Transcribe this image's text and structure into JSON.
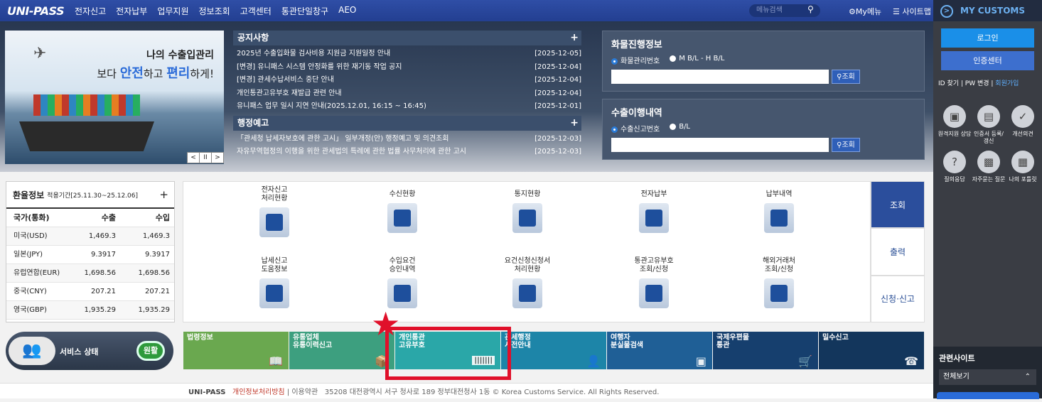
{
  "header": {
    "logo": "UNI-PASS",
    "menu": [
      "전자신고",
      "전자납부",
      "업무지원",
      "정보조회",
      "고객센터",
      "통관단일창구",
      "AEO"
    ],
    "search_placeholder": "메뉴검색",
    "mymenu": "My메뉴",
    "sitemap": "사이트맵"
  },
  "banner": {
    "line1": "나의 수출입관리",
    "line2_pre": "보다 ",
    "line2_a": "안전",
    "line2_mid": "하고 ",
    "line2_b": "편리",
    "line2_post": "하게!",
    "ctrl": [
      "<",
      "II",
      ">"
    ]
  },
  "notice": {
    "title": "공지사항",
    "items": [
      {
        "t": "2025년 수출입화물 검사비용 지원금 지원일정 안내",
        "d": "[2025-12-05]"
      },
      {
        "t": "[변경] 유니패스 시스템 안정화를 위한 재기동 작업 공지",
        "d": "[2025-12-04]"
      },
      {
        "t": "[변경] 관세수납서비스 중단 안내",
        "d": "[2025-12-04]"
      },
      {
        "t": "개인통관고유부호 재발급 관련 안내",
        "d": "[2025-12-04]"
      },
      {
        "t": "유니패스 업무 일시 지연 안내(2025.12.01, 16:15 ~ 16:45)",
        "d": "[2025-12-01]"
      }
    ]
  },
  "admin": {
    "title": "행정예고",
    "items": [
      {
        "t": "「관세청 납세자보호에 관한 고시」 일부개정(안) 행정예고 및 의견조회",
        "d": "[2025-12-03]"
      },
      {
        "t": "자유무역협정의 이행을 위한 관세법의 특례에 관한 법률 사무처리에 관한 고시",
        "d": "[2025-12-03]"
      }
    ]
  },
  "cargo": {
    "title": "화물진행정보",
    "r1": "화물관리번호",
    "r2": "M B/L - H B/L",
    "btn": "조회"
  },
  "export": {
    "title": "수출이행내역",
    "r1": "수출신고번호",
    "r2": "B/L",
    "btn": "조회"
  },
  "fx": {
    "title": "환율정보",
    "period": "적용기간[25.11.30~25.12.06]",
    "plus": "+",
    "cols": [
      "국가(통화)",
      "수출",
      "수입"
    ],
    "rows": [
      [
        "미국(USD)",
        "1,469.3",
        "1,469.3"
      ],
      [
        "일본(JPY)",
        "9.3917",
        "9.3917"
      ],
      [
        "유럽연합(EUR)",
        "1,698.56",
        "1,698.56"
      ],
      [
        "중국(CNY)",
        "207.21",
        "207.21"
      ],
      [
        "영국(GBP)",
        "1,935.29",
        "1,935.29"
      ]
    ]
  },
  "services": [
    {
      "l1": "전자신고",
      "l2": "처리현황"
    },
    {
      "l1": "수신현황",
      "l2": ""
    },
    {
      "l1": "통지현황",
      "l2": ""
    },
    {
      "l1": "전자납부",
      "l2": ""
    },
    {
      "l1": "납부내역",
      "l2": ""
    },
    {
      "l1": "납세신고",
      "l2": "도움정보"
    },
    {
      "l1": "수입요건",
      "l2": "승인내역"
    },
    {
      "l1": "요건신청신청서",
      "l2": "처리현황"
    },
    {
      "l1": "통관고유부호",
      "l2": "조회/신청"
    },
    {
      "l1": "해외거래처",
      "l2": "조회/신청"
    }
  ],
  "sidetabs": [
    "조회",
    "출력",
    "신청·신고"
  ],
  "status": {
    "label": "서비스 상태",
    "value": "원활"
  },
  "tiles": [
    {
      "l1": "법령정보",
      "l2": "",
      "color": "#6aa84f"
    },
    {
      "l1": "유통업체",
      "l2": "유통이력신고",
      "color": "#3d9f7f"
    },
    {
      "l1": "개인통관",
      "l2": "고유부호",
      "color": "#2aa7a8"
    },
    {
      "l1": "관세행정",
      "l2": "서전안내",
      "color": "#1d85a8"
    },
    {
      "l1": "여행자",
      "l2": "분실물검색",
      "color": "#1f5f96"
    },
    {
      "l1": "국제우편물",
      "l2": "통관",
      "color": "#163f6e"
    },
    {
      "l1": "밀수신고",
      "l2": "",
      "color": "#13365c"
    }
  ],
  "footer": {
    "brand": "UNI-PASS",
    "privacy": "개인정보처리방침",
    "terms": "이용약관",
    "addr": "35208 대전광역시 서구 청사로 189 정부대전청사 1동 © Korea Customs Service. All Rights Reserved."
  },
  "right": {
    "title": "MY CUSTOMS",
    "login": "로그인",
    "cert": "인증센터",
    "idfind": "ID 찾기",
    "pwchange": "PW 변경",
    "join": "회원가입",
    "icons": [
      {
        "l": "원격지원 상담"
      },
      {
        "l": "인증서 등록/갱신"
      },
      {
        "l": "개선의견"
      },
      {
        "l": "질의응답"
      },
      {
        "l": "자주묻는 질문"
      },
      {
        "l": "나의 포틀릿"
      }
    ],
    "related": "관련사이트",
    "related_sel": "전체보기"
  }
}
